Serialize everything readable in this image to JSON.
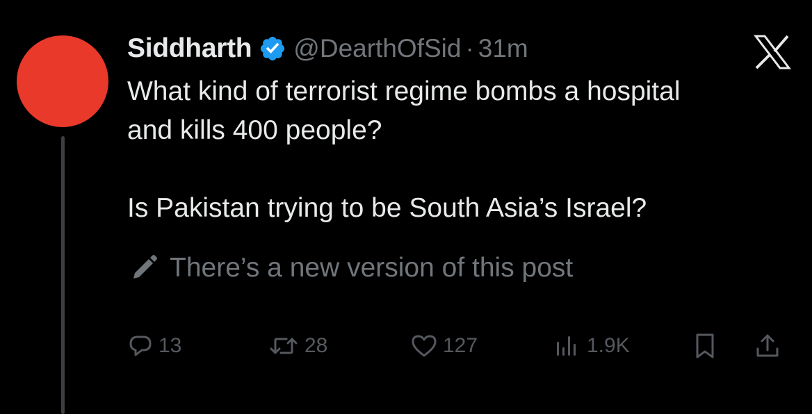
{
  "tweet": {
    "display_name": "Siddharth",
    "handle": "@DearthOfSid",
    "separator": "·",
    "time": "31m",
    "text": "What kind of terrorist regime bombs a hospital\nand kills 400 people?\n\nIs Pakistan trying to be South Asia’s Israel?",
    "edit_notice": "There’s a new version of this post",
    "avatar_color": "#e8392b",
    "verified_color": "#1d9bf0"
  },
  "actions": {
    "replies": "13",
    "reposts": "28",
    "likes": "127",
    "views": "1.9K"
  },
  "icons": {
    "verified": "verified-badge-icon",
    "brand": "x-logo-icon",
    "edit": "pencil-icon",
    "reply": "reply-icon",
    "repost": "repost-icon",
    "like": "heart-icon",
    "views": "views-icon",
    "bookmark": "bookmark-icon",
    "share": "share-icon"
  }
}
